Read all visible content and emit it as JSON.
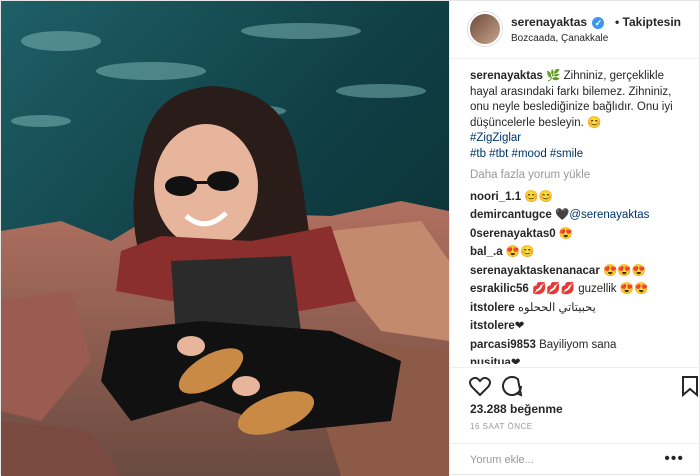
{
  "header": {
    "username": "serenayaktas",
    "follow_label": "Takiptesin",
    "location": "Bozcaada, Çanakkale"
  },
  "caption": {
    "username": "serenayaktas",
    "text": "🌿 Zihniniz, gerçeklikle hayal arasındaki farkı bilemez. Zihniniz, onu neyle beslediğinize bağlıdır. Onu iyi düşüncelerle besleyin. 😊",
    "tags_line1": "#ZigZiglar",
    "tags_line2": "#tb #tbt #mood #smile"
  },
  "load_more_label": "Daha fazla yorum yükle",
  "comments": [
    {
      "user": "noori_1.1",
      "text": "😊😊"
    },
    {
      "user": "demircantugce",
      "text": "🖤",
      "mention": "@serenayaktas"
    },
    {
      "user": "0serenayaktas0",
      "text": "😍"
    },
    {
      "user": "bal_.a",
      "text": "😍😊"
    },
    {
      "user": "serenayaktaskenanacar",
      "text": "😍😍😍"
    },
    {
      "user": "esrakilic56",
      "text": "💋💋💋 guzellik 😍😍"
    },
    {
      "user": "itstolere",
      "text": "يحبيتاتي الححلوه"
    },
    {
      "user": "itstolere",
      "text": "❤"
    },
    {
      "user": "parcasi9853",
      "text": "Bayiliyom sana"
    },
    {
      "user": "nusitua",
      "text": "❤"
    }
  ],
  "likes": "23.288 beğenme",
  "time_ago": "16 SAAT ÖNCE",
  "comment_placeholder": "Yorum ekle...",
  "icons": [
    "heart-icon",
    "comment-icon",
    "bookmark-icon",
    "verified-badge-icon",
    "more-options-icon"
  ],
  "colors": {
    "link": "#003569",
    "verified": "#3897f0",
    "muted": "#999999"
  }
}
